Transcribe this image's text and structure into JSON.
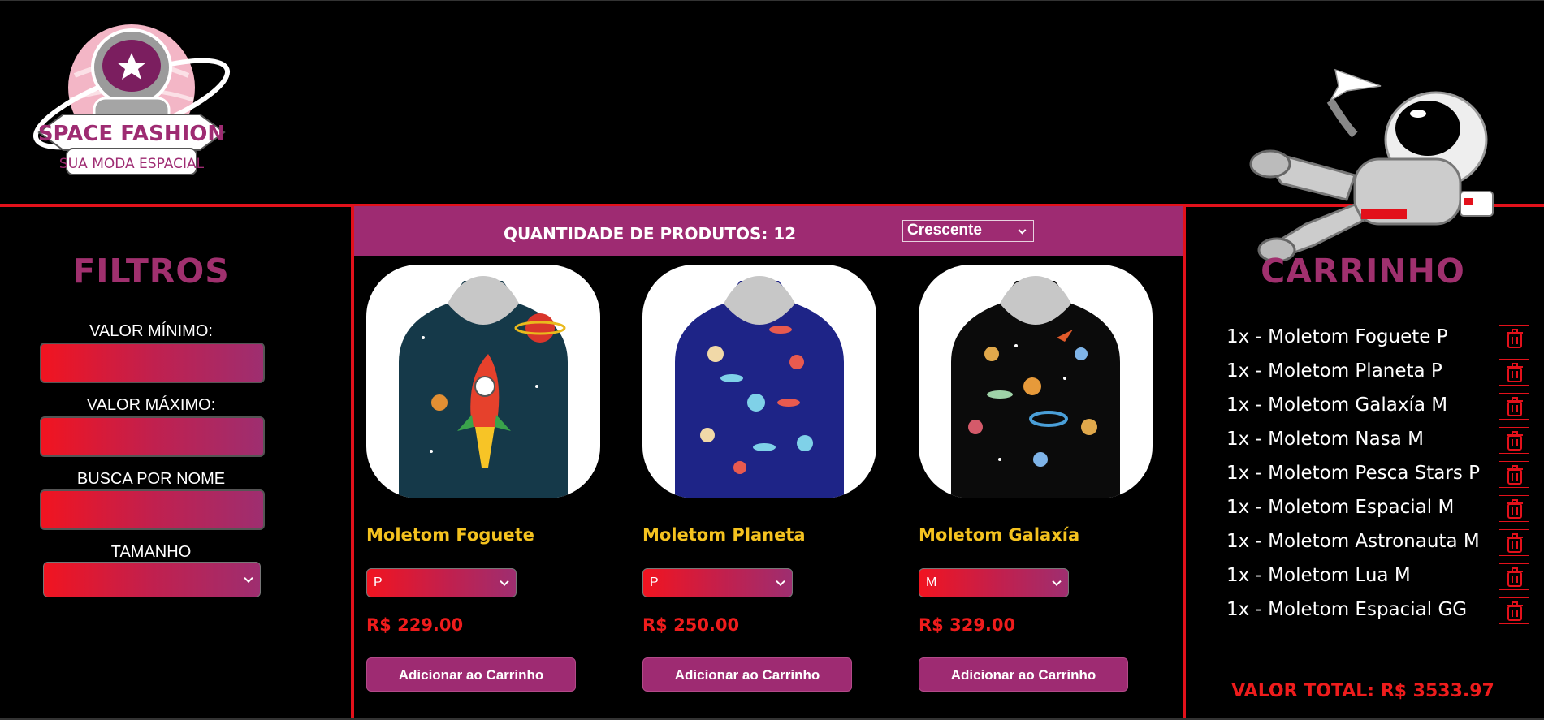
{
  "brand": {
    "name": "SPACE FASHION",
    "tagline": "SUA MODA ESPACIAL"
  },
  "colors": {
    "accent": "#9e2b72",
    "red": "#e3111b",
    "price": "#ee1c1c",
    "product_name": "#f4c21f"
  },
  "filters": {
    "title": "FILTROS",
    "min_label": "VALOR MÍNIMO:",
    "max_label": "VALOR MÁXIMO:",
    "search_label": "BUSCA POR NOME",
    "size_label": "TAMANHO",
    "min_value": "",
    "max_value": "",
    "search_value": "",
    "size_value": ""
  },
  "main": {
    "quantity_label": "QUANTIDADE DE PRODUTOS: 12",
    "order_value": "Crescente",
    "products": [
      {
        "name": "Moletom Foguete",
        "size": "P",
        "price": "R$ 229.00",
        "button": "Adicionar ao Carrinho"
      },
      {
        "name": "Moletom Planeta",
        "size": "P",
        "price": "R$ 250.00",
        "button": "Adicionar ao Carrinho"
      },
      {
        "name": "Moletom Galaxía",
        "size": "M",
        "price": "R$ 329.00",
        "button": "Adicionar ao Carrinho"
      }
    ]
  },
  "cart": {
    "title": "CARRINHO",
    "items": [
      "1x - Moletom Foguete P",
      "1x - Moletom Planeta P",
      "1x - Moletom Galaxía M",
      "1x - Moletom Nasa M",
      "1x - Moletom Pesca Stars P",
      "1x - Moletom Espacial M",
      "1x - Moletom Astronauta M",
      "1x - Moletom Lua M",
      "1x - Moletom Espacial GG"
    ],
    "total": "VALOR TOTAL: R$ 3533.97"
  }
}
